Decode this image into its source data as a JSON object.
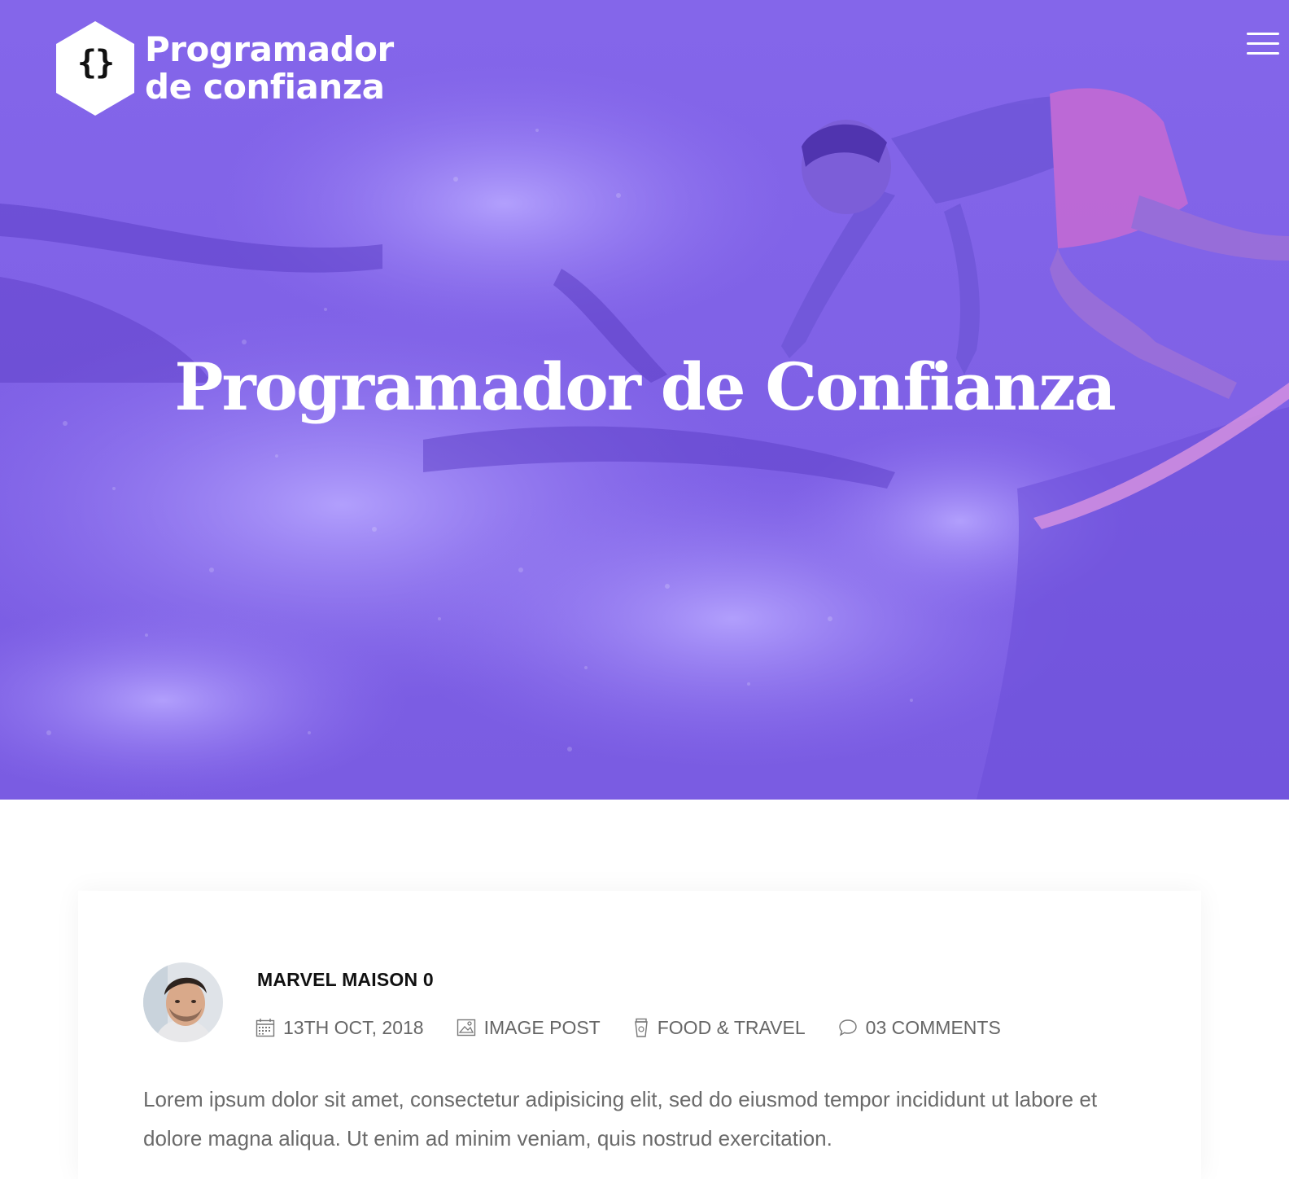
{
  "brand": {
    "logo_symbol": "{}",
    "name_line1": "Programador",
    "name_line2": "de confianza"
  },
  "header": {
    "menu_icon": "hamburger-menu-icon"
  },
  "hero": {
    "title": "Programador de Confianza",
    "overlay_color": "#7b5ce8"
  },
  "post": {
    "author": "MARVEL MAISON 0",
    "meta": {
      "date": "13TH OCT, 2018",
      "format": "IMAGE POST",
      "category": "FOOD & TRAVEL",
      "comments": "03 COMMENTS"
    },
    "excerpt": "Lorem ipsum dolor sit amet, consectetur adipisicing elit, sed do eiusmod tempor incididunt ut labore et dolore magna aliqua. Ut enim ad minim veniam, quis nostrud exercitation."
  }
}
